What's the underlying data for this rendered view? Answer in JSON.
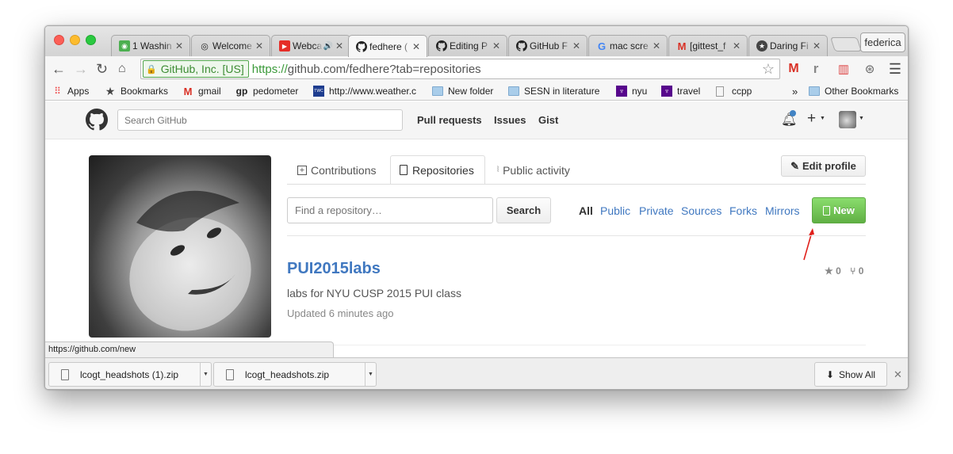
{
  "browser": {
    "profile_name": "federica",
    "tabs": [
      {
        "title": "1 Washin",
        "icon": "google-maps-icon"
      },
      {
        "title": "Welcome",
        "icon": "welcome-icon"
      },
      {
        "title": "Webca",
        "icon": "youtube-icon",
        "audio": "🔊"
      },
      {
        "title": "fedhere (",
        "icon": "github-icon",
        "active": true
      },
      {
        "title": "Editing P",
        "icon": "github-icon"
      },
      {
        "title": "GitHub F",
        "icon": "github-icon"
      },
      {
        "title": "mac scre",
        "icon": "google-icon"
      },
      {
        "title": "[gittest_f",
        "icon": "gmail-icon"
      },
      {
        "title": "Daring Fi",
        "icon": "daring-fireball-icon"
      }
    ],
    "ev_badge": "GitHub, Inc. [US]",
    "url_scheme": "https://",
    "url_rest": "github.com/fedhere?tab=repositories",
    "bookmarks": [
      "Apps",
      "Bookmarks",
      "gmail",
      "pedometer",
      "http://www.weather.c",
      "New folder",
      "SESN in literature",
      "nyu",
      "travel",
      "ccpp"
    ],
    "overflow": "»",
    "other_bookmarks": "Other Bookmarks",
    "status_url": "https://github.com/new",
    "downloads": [
      "lcogt_headshots (1).zip",
      "lcogt_headshots.zip"
    ],
    "show_all": "Show All",
    "colors": {
      "ev_green": "#3d8c34",
      "link_blue": "#4078c0",
      "new_button_green": "#60b044",
      "annotation_arrow": "#e0201b"
    }
  },
  "github": {
    "search_placeholder": "Search GitHub",
    "nav": [
      "Pull requests",
      "Issues",
      "Gist"
    ],
    "profile_tabs": [
      "Contributions",
      "Repositories",
      "Public activity"
    ],
    "edit_profile": "Edit profile",
    "find_placeholder": "Find a repository…",
    "search_button": "Search",
    "filters": [
      "All",
      "Public",
      "Private",
      "Sources",
      "Forks",
      "Mirrors"
    ],
    "new_button": "New",
    "repo": {
      "name": "PUI2015labs",
      "description": "labs for NYU CUSP 2015 PUI class",
      "updated": "Updated 6 minutes ago",
      "stars": "0",
      "forks": "0"
    }
  }
}
